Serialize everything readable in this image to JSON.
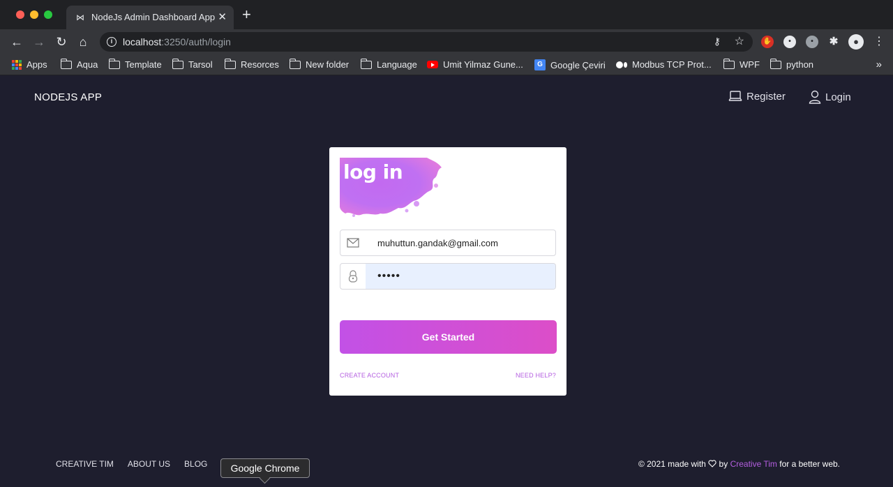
{
  "browser": {
    "tab_title": "NodeJs Admin Dashboard App",
    "tab_close": "✕",
    "new_tab": "+",
    "url_host": "localhost",
    "url_path": ":3250/auth/login",
    "bookmarks_more": "»",
    "bookmarks": [
      {
        "label": "Apps",
        "icon": "apps-grid-icon"
      },
      {
        "label": "Aqua",
        "icon": "folder-icon"
      },
      {
        "label": "Template",
        "icon": "folder-icon"
      },
      {
        "label": "Tarsol",
        "icon": "folder-icon"
      },
      {
        "label": "Resorces",
        "icon": "folder-icon"
      },
      {
        "label": "New folder",
        "icon": "folder-icon"
      },
      {
        "label": "Language",
        "icon": "folder-icon"
      },
      {
        "label": "Umit Yilmaz Gune...",
        "icon": "youtube-icon"
      },
      {
        "label": "Google Çeviri",
        "icon": "google-translate-icon"
      },
      {
        "label": "Modbus TCP Prot...",
        "icon": "medium-icon"
      },
      {
        "label": "WPF",
        "icon": "folder-icon"
      },
      {
        "label": "python",
        "icon": "folder-icon"
      }
    ],
    "tooltip": "Google Chrome"
  },
  "app": {
    "brand": "NODEJS APP",
    "nav": {
      "register": "Register",
      "login": "Login"
    },
    "card": {
      "title": "log in",
      "email_value": "muhuttun.gandak@gmail.com",
      "password_value": "•••••",
      "submit": "Get Started",
      "create_account": "CREATE ACCOUNT",
      "need_help": "NEED HELP?"
    },
    "footer": {
      "links": [
        "CREATIVE TIM",
        "ABOUT US",
        "BLOG"
      ],
      "credit_prefix": "© 2021 made with",
      "credit_by": "by",
      "credit_author": "Creative Tim",
      "credit_suffix": "for a better web."
    }
  },
  "colors": {
    "accent": "#c251e6",
    "page_bg": "#1e1e2e",
    "link": "#b45ee0"
  }
}
